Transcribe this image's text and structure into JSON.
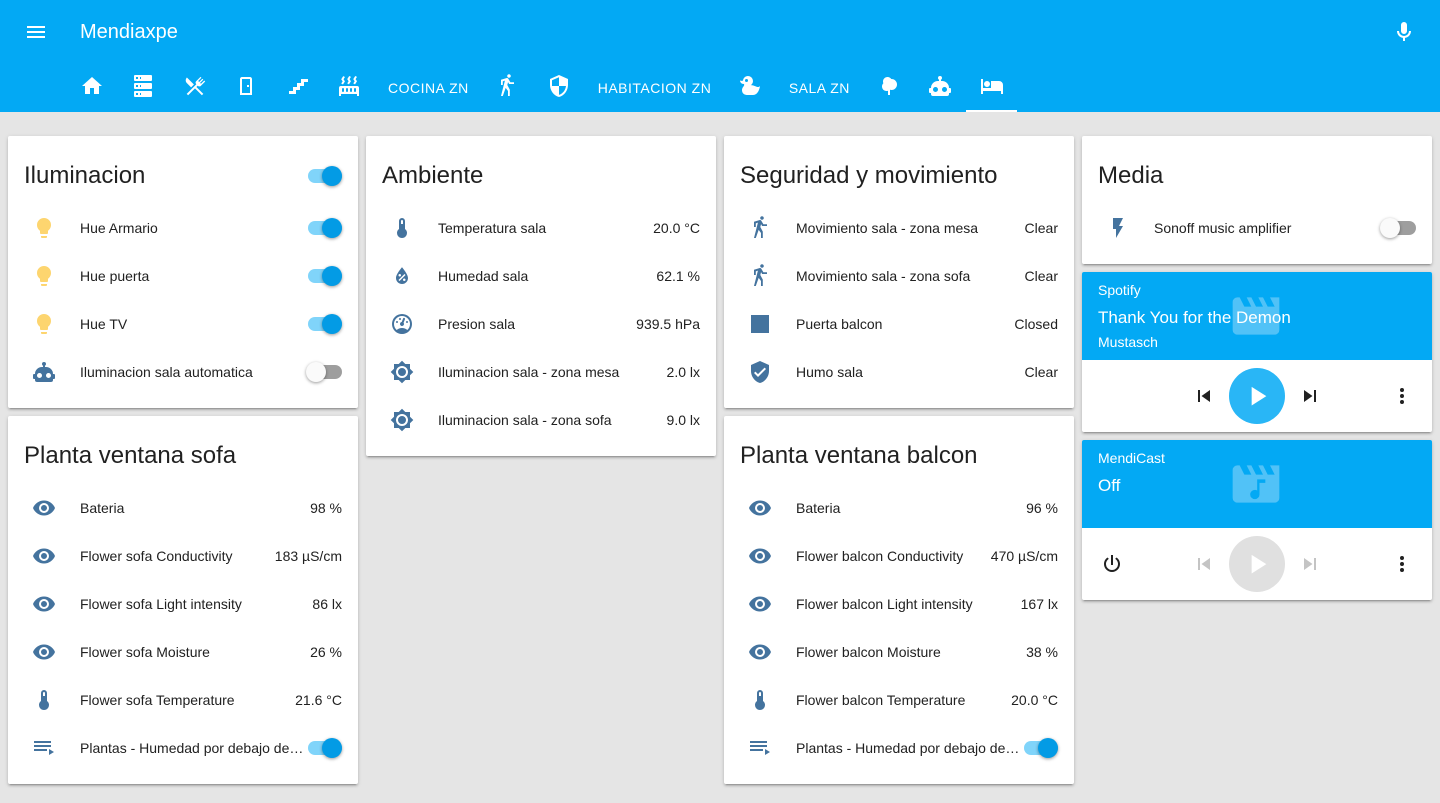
{
  "header": {
    "title": "Mendiaxpe"
  },
  "tabs": [
    {
      "type": "icon",
      "icon": "home-icon"
    },
    {
      "type": "icon",
      "icon": "server-icon"
    },
    {
      "type": "icon",
      "icon": "silverware-icon"
    },
    {
      "type": "icon",
      "icon": "door-icon"
    },
    {
      "type": "icon",
      "icon": "stairs-icon"
    },
    {
      "type": "icon",
      "icon": "radiator-icon"
    },
    {
      "type": "text",
      "label": "COCINA ZN"
    },
    {
      "type": "icon",
      "icon": "walk-icon"
    },
    {
      "type": "icon",
      "icon": "shield-icon"
    },
    {
      "type": "text",
      "label": "HABITACION ZN"
    },
    {
      "type": "icon",
      "icon": "duck-icon"
    },
    {
      "type": "text",
      "label": "SALA ZN"
    },
    {
      "type": "icon",
      "icon": "tree-icon"
    },
    {
      "type": "icon",
      "icon": "robot-icon"
    },
    {
      "type": "icon",
      "icon": "sofa-icon",
      "active": true
    }
  ],
  "cards": {
    "iluminacion": {
      "title": "Iluminacion",
      "toggle": "on",
      "rows": [
        {
          "icon": "bulb-icon",
          "name": "Hue Armario",
          "toggle": "on"
        },
        {
          "icon": "bulb-icon",
          "name": "Hue puerta",
          "toggle": "on"
        },
        {
          "icon": "bulb-icon",
          "name": "Hue TV",
          "toggle": "on"
        },
        {
          "icon": "robot-icon",
          "name": "Iluminacion sala automatica",
          "toggle": "off"
        }
      ]
    },
    "ambiente": {
      "title": "Ambiente",
      "rows": [
        {
          "icon": "thermometer-icon",
          "name": "Temperatura sala",
          "value": "20.0 °C"
        },
        {
          "icon": "water-percent-icon",
          "name": "Humedad sala",
          "value": "62.1 %"
        },
        {
          "icon": "gauge-icon",
          "name": "Presion sala",
          "value": "939.5 hPa"
        },
        {
          "icon": "brightness-icon",
          "name": "Iluminacion sala - zona mesa",
          "value": "2.0 lx"
        },
        {
          "icon": "brightness-icon",
          "name": "Iluminacion sala - zona sofa",
          "value": "9.0 lx"
        }
      ]
    },
    "seguridad": {
      "title": "Seguridad y movimiento",
      "rows": [
        {
          "icon": "walk-icon",
          "name": "Movimiento sala - zona mesa",
          "value": "Clear"
        },
        {
          "icon": "walk-icon",
          "name": "Movimiento sala - zona sofa",
          "value": "Clear"
        },
        {
          "icon": "square-icon",
          "name": "Puerta balcon",
          "value": "Closed"
        },
        {
          "icon": "shield-check-icon",
          "name": "Humo sala",
          "value": "Clear"
        }
      ]
    },
    "media": {
      "title": "Media",
      "rows": [
        {
          "icon": "flash-icon",
          "name": "Sonoff music amplifier",
          "toggle": "off"
        }
      ]
    },
    "planta_sofa": {
      "title": "Planta ventana sofa",
      "rows": [
        {
          "icon": "eye-icon",
          "name": "Bateria",
          "value": "98 %"
        },
        {
          "icon": "eye-icon",
          "name": "Flower sofa Conductivity",
          "value": "183 µS/cm"
        },
        {
          "icon": "eye-icon",
          "name": "Flower sofa Light intensity",
          "value": "86 lx"
        },
        {
          "icon": "eye-icon",
          "name": "Flower sofa Moisture",
          "value": "26 %"
        },
        {
          "icon": "thermometer-icon",
          "name": "Flower sofa Temperature",
          "value": "21.6 °C"
        },
        {
          "icon": "playlist-play-icon",
          "name": "Plantas - Humedad por debajo del umbral",
          "toggle": "on"
        }
      ]
    },
    "planta_balcon": {
      "title": "Planta ventana balcon",
      "rows": [
        {
          "icon": "eye-icon",
          "name": "Bateria",
          "value": "96 %"
        },
        {
          "icon": "eye-icon",
          "name": "Flower balcon Conductivity",
          "value": "470 µS/cm"
        },
        {
          "icon": "eye-icon",
          "name": "Flower balcon Light intensity",
          "value": "167 lx"
        },
        {
          "icon": "eye-icon",
          "name": "Flower balcon Moisture",
          "value": "38 %"
        },
        {
          "icon": "thermometer-icon",
          "name": "Flower balcon Temperature",
          "value": "20.0 °C"
        },
        {
          "icon": "playlist-play-icon",
          "name": "Plantas - Humedad por debajo del umbral",
          "toggle": "on"
        }
      ]
    }
  },
  "players": {
    "spotify": {
      "app": "Spotify",
      "title": "Thank You for the Demon",
      "artist": "Mustasch"
    },
    "mendicast": {
      "app": "MendiCast",
      "title": "Off"
    }
  },
  "colors": {
    "primary": "#03a9f4",
    "icon": "#44739e",
    "bulb_on": "#fdd56f",
    "toggle_on": "#039be5"
  }
}
